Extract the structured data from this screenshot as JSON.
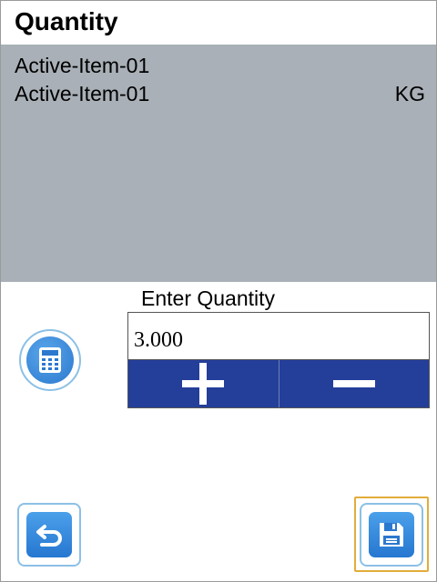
{
  "header": {
    "title": "Quantity"
  },
  "item": {
    "line1": "Active-Item-01",
    "line2": "Active-Item-01",
    "unit": "KG"
  },
  "quantity": {
    "label": "Enter Quantity",
    "value": "3.000"
  },
  "icons": {
    "calculator": "calculator-icon",
    "plus": "plus-icon",
    "minus": "minus-icon",
    "back": "back-arrow-icon",
    "save": "save-icon"
  },
  "colors": {
    "info_panel_bg": "#a9b0b7",
    "stepper_bg": "#243f9a",
    "icon_blue": "#2b78cf",
    "focus_outline": "#e2ad3a"
  }
}
